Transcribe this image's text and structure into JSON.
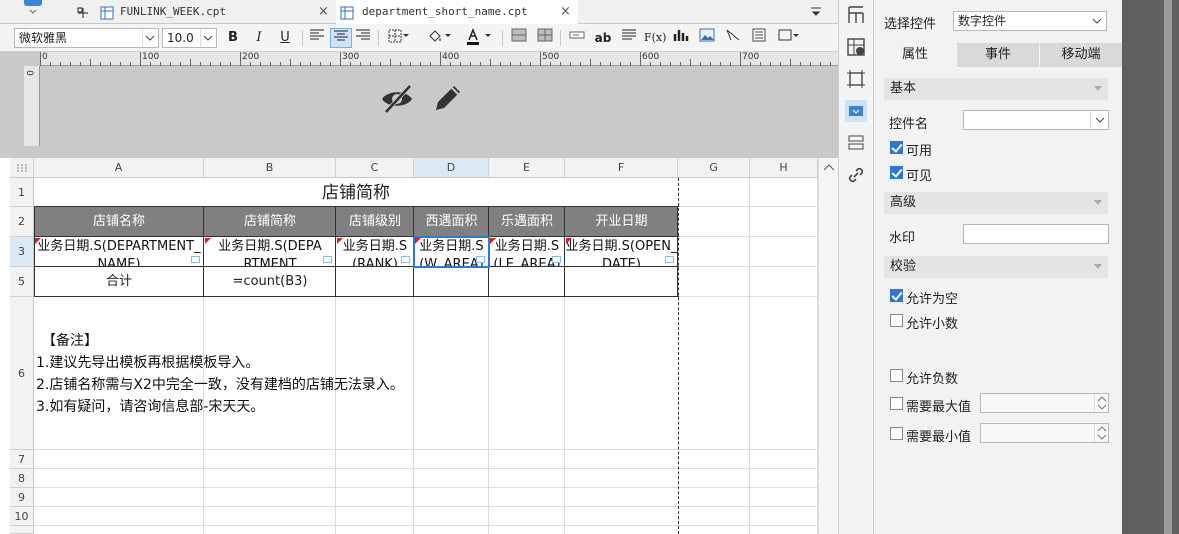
{
  "tabs": [
    {
      "label": "FUNLINK_WEEK.cpt",
      "active": false
    },
    {
      "label": "department_short_name.cpt",
      "active": true
    }
  ],
  "toolbar": {
    "font_family": "微软雅黑",
    "font_size": "10.0",
    "bold": "B",
    "italic": "I",
    "underline": "U",
    "text_tool": "ab",
    "formula": "F(x)"
  },
  "ruler": {
    "h_ticks": [
      "0",
      "100",
      "200",
      "300",
      "400",
      "500",
      "600",
      "700"
    ],
    "v_tick": "0"
  },
  "sheet": {
    "columns": [
      "A",
      "B",
      "C",
      "D",
      "E",
      "F",
      "G",
      "H"
    ],
    "rows": [
      "1",
      "2",
      "3",
      "5",
      "6",
      "7",
      "8",
      "9",
      "10"
    ],
    "title": "店铺简称",
    "headers": [
      "店铺名称",
      "店铺简称",
      "店铺级别",
      "西遇面积",
      "乐遇面积",
      "开业日期"
    ],
    "row3": [
      "业务日期.S(DEPARTMENT_NAME)",
      "业务日期.S(DEPARTMENT",
      "业务日期.S(RANK)",
      "业务日期.S(W_AREA)",
      "业务日期.S(LE_AREA)",
      "业务日期.S(OPEN_DATE)"
    ],
    "row5": [
      "合计",
      "=count(B3)"
    ],
    "notes": [
      "【备注】",
      "1.建议先导出模板再根据模板导入。",
      "2.店铺名称需与X2中完全一致，没有建档的店铺无法录入。",
      "3.如有疑问，请咨询信息部-宋天天。"
    ]
  },
  "panel": {
    "select_control_label": "选择控件",
    "select_control_value": "数字控件",
    "tabs": [
      "属性",
      "事件",
      "移动端"
    ],
    "sections": {
      "basic": "基本",
      "advanced": "高级",
      "validate": "校验"
    },
    "control_name_label": "控件名",
    "control_name_value": "",
    "enabled_label": "可用",
    "visible_label": "可见",
    "watermark_label": "水印",
    "watermark_value": "",
    "allow_empty_label": "允许为空",
    "allow_decimal_label": "允许小数",
    "allow_negative_label": "允许负数",
    "need_max_label": "需要最大值",
    "need_min_label": "需要最小值",
    "enabled": true,
    "visible": true,
    "allow_empty": true,
    "allow_decimal": false,
    "allow_negative": false,
    "need_max": false,
    "need_min": false
  },
  "colors": {
    "header_bg": "#808080",
    "accent": "#2b78d8",
    "selection": "#cfe3f7"
  }
}
